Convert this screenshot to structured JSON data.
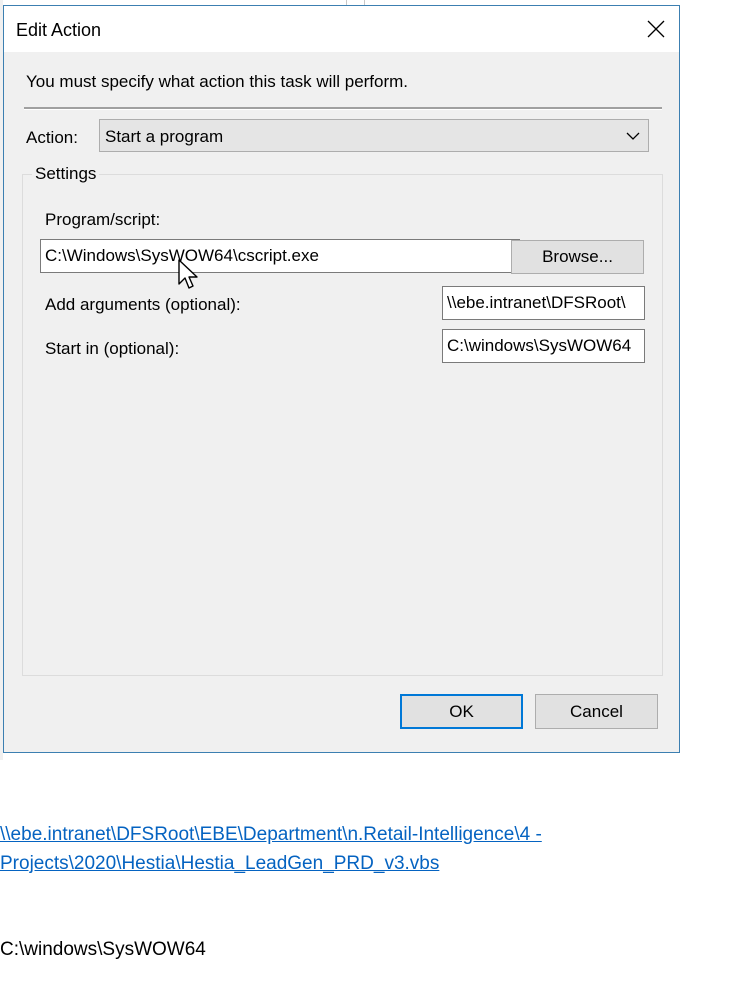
{
  "dialog": {
    "title": "Edit Action",
    "instruction": "You must specify what action this task will perform.",
    "action_label": "Action:",
    "action_value": "Start a program",
    "settings_legend": "Settings",
    "program_label": "Program/script:",
    "program_value": "C:\\Windows\\SysWOW64\\cscript.exe",
    "browse_label": "Browse...",
    "arguments_label": "Add arguments (optional):",
    "arguments_value": "\\\\ebe.intranet\\DFSRoot\\",
    "startin_label": "Start in (optional):",
    "startin_value": "C:\\windows\\SysWOW64",
    "ok_label": "OK",
    "cancel_label": "Cancel"
  },
  "document": {
    "link_text": "\\\\ebe.intranet\\DFSRoot\\EBE\\Department\\n.Retail-Intelligence\\4 - Projects\\2020\\Hestia\\Hestia_LeadGen_PRD_v3.vbs",
    "plain_text": "C:\\windows\\SysWOW64"
  },
  "icons": {
    "close": "close-icon",
    "dropdown": "chevron-down-icon",
    "cursor": "mouse-pointer-icon"
  },
  "colors": {
    "dialog_bg": "#f0f0f0",
    "accent_border": "#0078d7",
    "link": "#0563c1"
  }
}
